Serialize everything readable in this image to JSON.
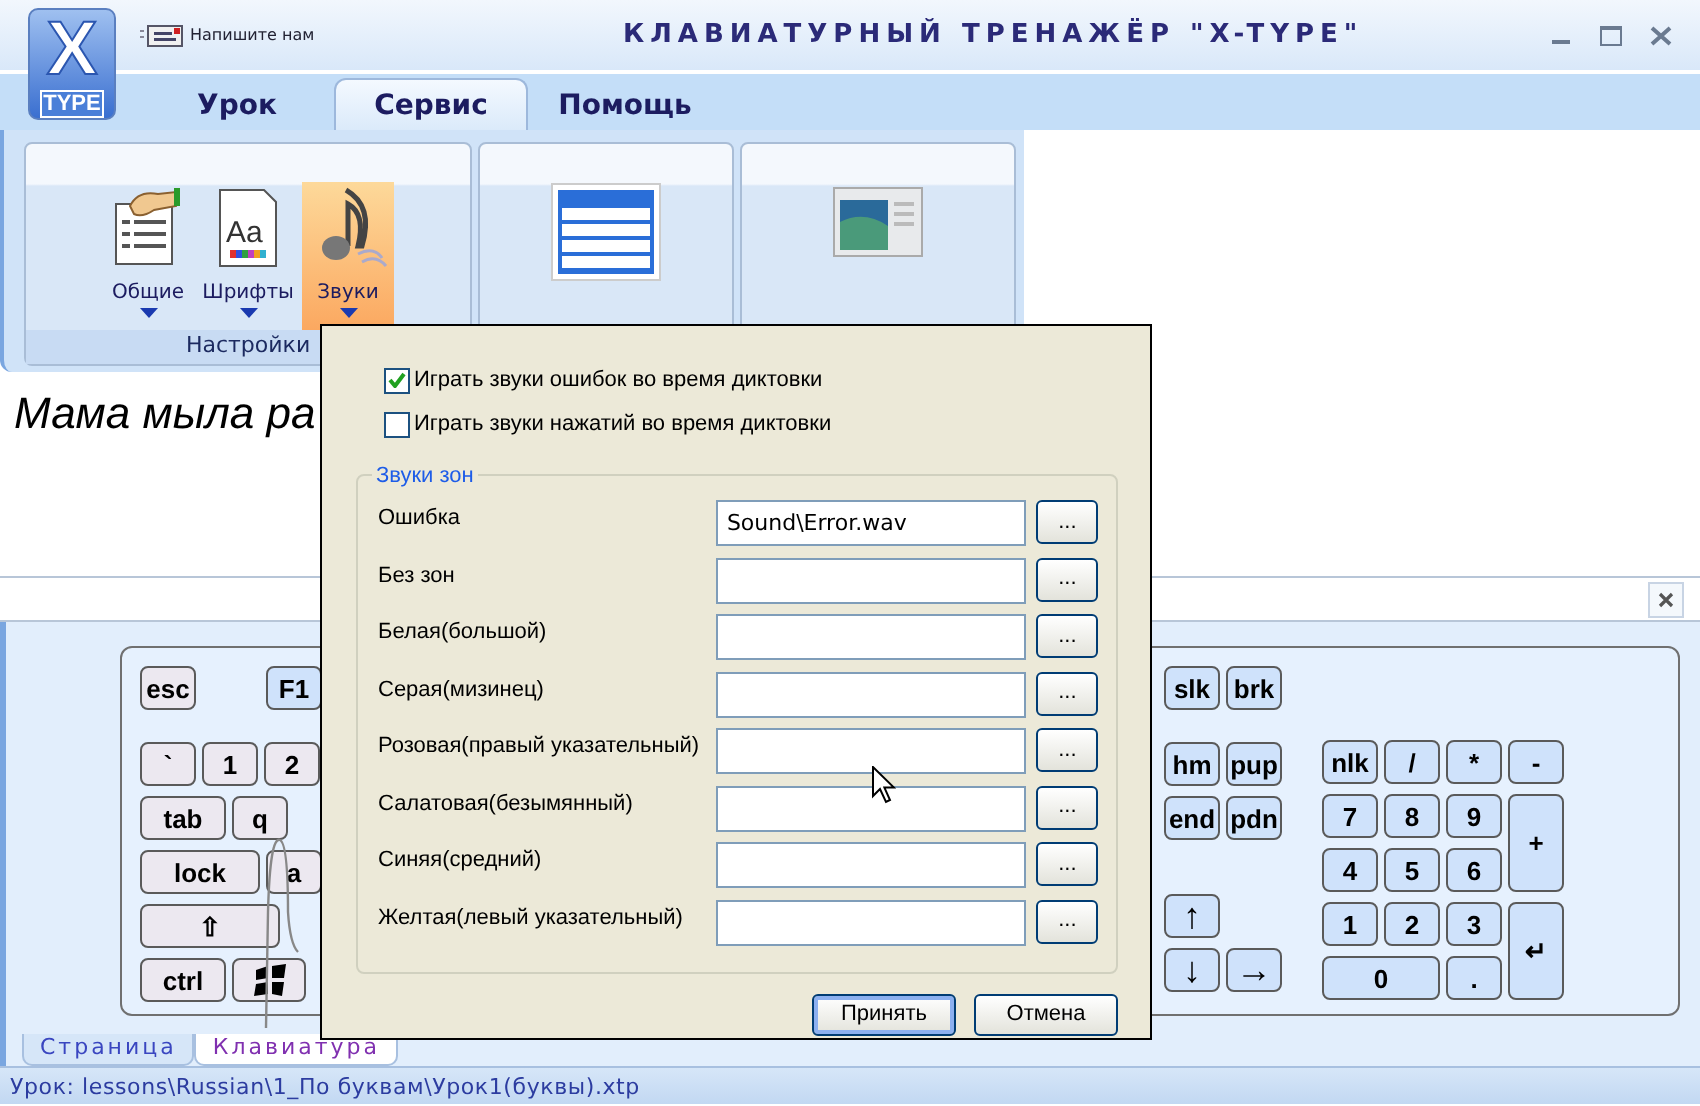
{
  "window": {
    "title": "КЛАВИАТУРНЫЙ ТРЕНАЖЁР \"X-TYPE\"",
    "logo": {
      "top": "X",
      "bottom": "TYPE"
    },
    "contact_link": "Напишите нам"
  },
  "tabs": [
    {
      "label": "Урок",
      "selected": false
    },
    {
      "label": "Сервис",
      "selected": true
    },
    {
      "label": "Помощь",
      "selected": false
    }
  ],
  "ribbon": {
    "groups": [
      {
        "label": "Настройки",
        "buttons": [
          {
            "kind": "settings",
            "label": "Общие",
            "dropdown": true,
            "selected": false
          },
          {
            "kind": "fonts",
            "label": "Шрифты",
            "icon_text": "Aa",
            "dropdown": true,
            "selected": false
          },
          {
            "kind": "sounds",
            "label": "Звуки",
            "dropdown": true,
            "selected": true
          }
        ]
      },
      {
        "buttons": [
          {
            "kind": "table",
            "selected": false
          }
        ]
      },
      {
        "buttons": [
          {
            "kind": "window",
            "selected": false
          }
        ]
      }
    ]
  },
  "lesson_text": "Мама мыла ра",
  "keyboard": {
    "left": {
      "function_row": [
        {
          "label": "esc",
          "kind": "key",
          "highlighted": false
        },
        {
          "label": "F1",
          "kind": "key",
          "highlighted": true
        }
      ],
      "rows": [
        {
          "keys": [
            {
              "label": "`",
              "kind": "key",
              "highlighted": false
            },
            {
              "label": "1",
              "kind": "key",
              "highlighted": false
            },
            {
              "label": "2",
              "kind": "key",
              "highlighted": false
            }
          ]
        },
        {
          "keys": [
            {
              "label": "tab",
              "kind": "wide",
              "highlighted": false
            },
            {
              "label": "q",
              "kind": "key",
              "highlighted": false
            }
          ]
        },
        {
          "keys": [
            {
              "label": "lock",
              "kind": "wider",
              "highlighted": false
            },
            {
              "label": "a",
              "kind": "key",
              "highlighted": false
            }
          ]
        },
        {
          "keys": [
            {
              "label": "⇧",
              "kind": "widest",
              "highlighted": false
            }
          ]
        },
        {
          "keys": [
            {
              "label": "ctrl",
              "kind": "wide",
              "highlighted": false
            },
            {
              "kind": "windows",
              "highlighted": false
            }
          ]
        }
      ]
    },
    "nav": {
      "function_row": [
        "slk",
        "brk"
      ],
      "rows": [
        [
          "hm",
          "pup"
        ],
        [
          "end",
          "pdn"
        ]
      ],
      "arrows": [
        [
          "↑"
        ],
        [
          "↓",
          "→"
        ]
      ]
    },
    "numpad": [
      {
        "label": "nlk",
        "kind": "key"
      },
      {
        "label": "/",
        "kind": "key"
      },
      {
        "label": "*",
        "kind": "key"
      },
      {
        "label": "-",
        "kind": "key"
      },
      {
        "label": "7",
        "kind": "key"
      },
      {
        "label": "8",
        "kind": "key"
      },
      {
        "label": "9",
        "kind": "key"
      },
      {
        "label": "+",
        "kind": "tall"
      },
      {
        "label": "4",
        "kind": "key"
      },
      {
        "label": "5",
        "kind": "key"
      },
      {
        "label": "6",
        "kind": "key"
      },
      {
        "label": "1",
        "kind": "key"
      },
      {
        "label": "2",
        "kind": "key"
      },
      {
        "label": "3",
        "kind": "key"
      },
      {
        "label": "↵",
        "kind": "tall"
      },
      {
        "label": "0",
        "kind": "wide"
      },
      {
        "label": ".",
        "kind": "key"
      }
    ]
  },
  "bottom_tabs": [
    {
      "label": "Страница",
      "selected": false
    },
    {
      "label": "Клавиатура",
      "selected": true
    }
  ],
  "status_bar": "Урок: lessons\\Russian\\1_По буквам\\Урок1(буквы).xtp",
  "dialog": {
    "checkboxes": [
      {
        "label": "Играть звуки ошибок во время диктовки",
        "checked": true
      },
      {
        "label": "Играть звуки нажатий во время диктовки",
        "checked": false
      }
    ],
    "zone_sounds": {
      "title": "Звуки зон",
      "rows": [
        {
          "label": "Ошибка",
          "value": "Sound\\Error.wav",
          "button": "..."
        },
        {
          "label": "Без зон",
          "button": "..."
        },
        {
          "label": "Белая(большой)",
          "button": "..."
        },
        {
          "label": "Серая(мизинец)",
          "button": "..."
        },
        {
          "label": "Розовая(правый указательный)",
          "button": "..."
        },
        {
          "label": "Салатовая(безымянный)",
          "button": "..."
        },
        {
          "label": "Синяя(средний)",
          "button": "..."
        },
        {
          "label": "Желтая(левый указательный)",
          "button": "..."
        }
      ]
    },
    "buttons": [
      {
        "label": "Принять",
        "default": true
      },
      {
        "label": "Отмена",
        "default": false
      }
    ]
  }
}
